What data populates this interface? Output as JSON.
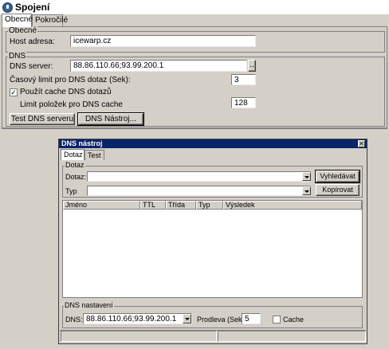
{
  "window": {
    "title": "Spojení"
  },
  "tabs": [
    {
      "label": "Obecné"
    },
    {
      "label": "Pokročilé"
    }
  ],
  "general": {
    "group_label": "Obecné",
    "host_label": "Host adresa:",
    "host_value": "icewarp.cz"
  },
  "dns": {
    "group_label": "DNS",
    "server_label": "DNS server:",
    "server_value": "88.86.110.66;93.99.200.1",
    "browse_label": "..",
    "timeout_label": "Časový limit pro DNS dotaz (Sek):",
    "timeout_value": "3",
    "use_cache_label": "Použít cache DNS dotazů",
    "use_cache_checked": true,
    "cache_limit_label": "Limit položek pro DNS cache",
    "cache_limit_value": "128",
    "test_button": "Test DNS serveru",
    "tools_button": "DNS Nástroj..."
  },
  "dns_tool": {
    "title": "DNS nástroj",
    "close_label": "✕",
    "tabs": [
      {
        "label": "Dotaz"
      },
      {
        "label": "Test"
      }
    ],
    "query_group_label": "Dotaz",
    "query_label": "Dotaz:",
    "query_value": "",
    "type_label": "Typ",
    "type_value": "",
    "search_button": "Vyhledávat",
    "copy_button": "Kopírovat",
    "columns": [
      {
        "label": "Jméno"
      },
      {
        "label": "TTL"
      },
      {
        "label": "Třída"
      },
      {
        "label": "Typ"
      },
      {
        "label": "Výsledek"
      }
    ],
    "settings_group_label": "DNS nastavení",
    "dns_label": "DNS:",
    "dns_value": "88.86.110.66;93.99.200.1",
    "delay_label": "Prodleva (Sek):",
    "delay_value": "5",
    "cache_label": "Cache",
    "cache_checked": false
  },
  "icons": {
    "app": "connection-globe-icon",
    "combo_arrow": "chevron-down-icon",
    "checkmark": "checkmark-icon"
  },
  "colors": {
    "face": "#d4d0c8",
    "dialog_title_bg": "#0a246a",
    "dialog_title_fg": "#ffffff"
  }
}
